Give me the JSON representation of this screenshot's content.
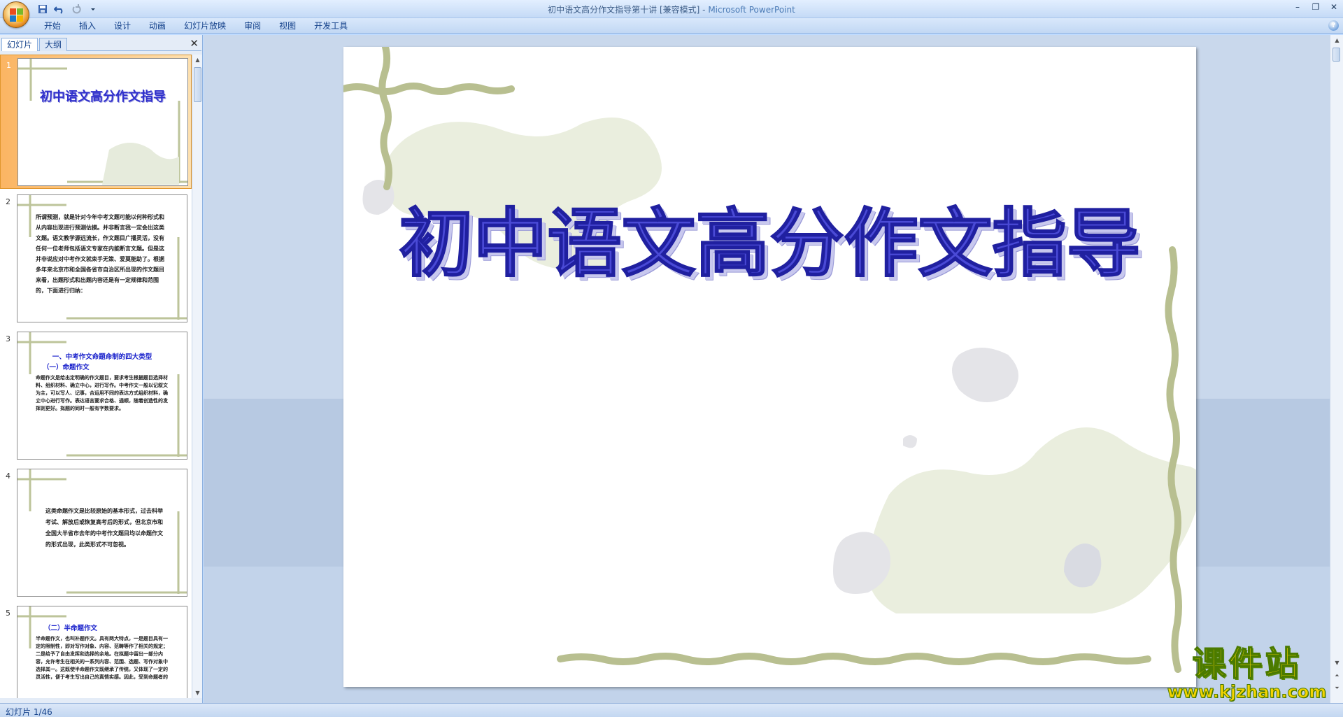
{
  "window": {
    "title": "初中语文高分作文指导第十讲 [兼容模式]",
    "separator": " - ",
    "app_name": "Microsoft PowerPoint",
    "controls": [
      "–",
      "❐",
      "✕"
    ]
  },
  "ribbon": {
    "tabs": [
      "开始",
      "插入",
      "设计",
      "动画",
      "幻灯片放映",
      "审阅",
      "视图",
      "开发工具"
    ]
  },
  "left_pane": {
    "tabs": [
      "幻灯片",
      "大纲"
    ],
    "close": "✕"
  },
  "thumbnails": [
    {
      "num": "1",
      "title": "初中语文高分作文指导"
    },
    {
      "num": "2",
      "text": "所谓预测，就是针对今年中考文题可能以何种形式和从内容出现进行预测估摸。并非断言我一定会出这类文题。语文教学源远流长，作文题目广播灵活，没有任何一位老师包括语文专家在内能断言文题。但是这并非说应对中考作文就束手无策、爱莫能助了。根据多年来北京市和全国各省市自治区所出现的作文题目来看，出题形式和出题内容还是有一定规律和范围的，下面进行归纳："
    },
    {
      "num": "3",
      "head1": "一、中考作文命题命制的四大类型",
      "head2": "（一）命题作文",
      "text": "命题作文是给出定明确的作文题目，要求考生根据题目选择材料、组织材料、确立中心，进行写作。中考作文一般以记叙文为主，可以写人、记事，合运用不同的表达方式组织材料，确立中心进行写作。表达语言要求合格、通顺，随着创造性的发挥则更好。拟题的同时一般有字数要求。"
    },
    {
      "num": "4",
      "text": "这类命题作文是比较原始的基本形式，过去科举考试、解放后或恢复高考后的形式，但北京市和全国大半省市去年的中考作文题目均以命题作文的形式出现，此类形式不可忽视。"
    },
    {
      "num": "5",
      "head1": "（二）半命题作文",
      "text": "半命题作文，也叫补题作文。具有两大特点，一是题目具有一定的限制性，即对写作对象、内容、范畴等作了相关的规定；二是给予了自由发挥和选择的余地。在拟题中留出一部分内容，允许考生在相关的一系列内容、范围、选题、写作对象中选择其一。这既使半命题作文既继承了传统，又体现了一定的灵活性，便于考生写出自己的真情实感。因此，受到命题者的"
    }
  ],
  "main_slide": {
    "title": "初中语文高分作文指导"
  },
  "statusbar": {
    "slide_indicator": "幻灯片 1/46"
  },
  "watermark": {
    "cn": "课件站",
    "url": "www.kjzhan.com"
  },
  "colors": {
    "ribbon": "#c2d8f4",
    "title_text": "#4a4ad6",
    "selected_thumb": "#fbb563"
  }
}
